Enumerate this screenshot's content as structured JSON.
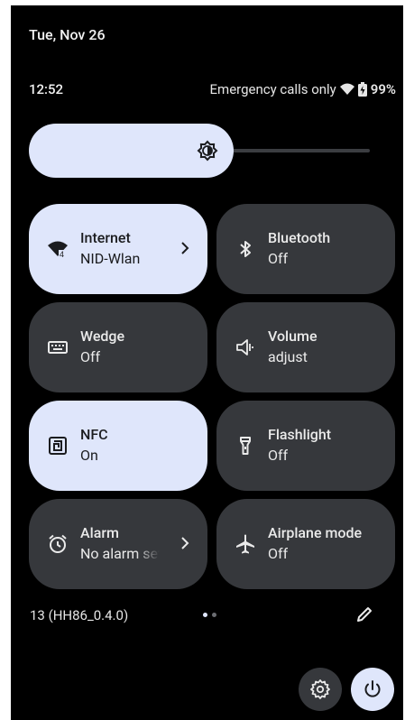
{
  "status": {
    "date": "Tue, Nov 26",
    "time": "12:52",
    "network_text": "Emergency calls only",
    "battery_percent": "99%"
  },
  "brightness": {
    "level_fraction": 0.6,
    "icon": "brightness-icon"
  },
  "tiles": [
    {
      "key": "internet",
      "title": "Internet",
      "subtitle": "NID-Wlan",
      "state": "on",
      "icon": "wifi-icon",
      "has_chevron": true
    },
    {
      "key": "bluetooth",
      "title": "Bluetooth",
      "subtitle": "Off",
      "state": "off",
      "icon": "bluetooth-icon",
      "has_chevron": false
    },
    {
      "key": "wedge",
      "title": "Wedge",
      "subtitle": "Off",
      "state": "off",
      "icon": "keyboard-icon",
      "has_chevron": false
    },
    {
      "key": "volume",
      "title": "Volume",
      "subtitle": "adjust",
      "state": "off",
      "icon": "volume-icon",
      "has_chevron": false
    },
    {
      "key": "nfc",
      "title": "NFC",
      "subtitle": "On",
      "state": "on",
      "icon": "nfc-icon",
      "has_chevron": false
    },
    {
      "key": "flashlight",
      "title": "Flashlight",
      "subtitle": "Off",
      "state": "off",
      "icon": "flashlight-icon",
      "has_chevron": false
    },
    {
      "key": "alarm",
      "title": "Alarm",
      "subtitle": "No alarm set",
      "state": "off",
      "icon": "alarm-icon",
      "has_chevron": true
    },
    {
      "key": "airplane",
      "title": "Airplane mode",
      "subtitle": "Off",
      "state": "off",
      "icon": "airplane-icon",
      "has_chevron": false
    }
  ],
  "footer": {
    "build": "13 (HH86_0.4.0)",
    "page_indicator": {
      "current": 1,
      "total": 2
    }
  },
  "colors": {
    "tile_on": "#dfe6fb",
    "tile_off": "#36383c",
    "background": "#000000"
  }
}
